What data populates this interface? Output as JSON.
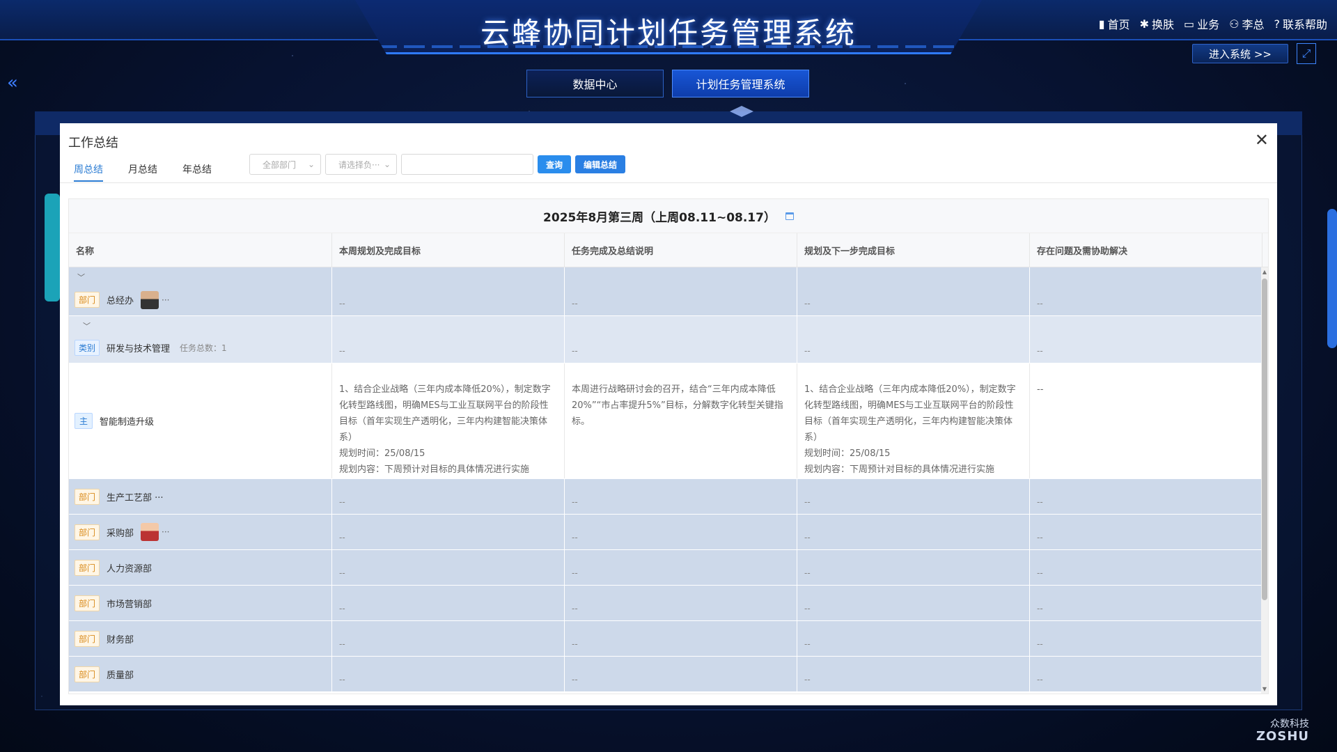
{
  "header": {
    "system_title": "云蜂协同计划任务管理系统",
    "nav": [
      {
        "icon": "bar-chart-icon",
        "label": "首页"
      },
      {
        "icon": "skin-icon",
        "label": "换肤"
      },
      {
        "icon": "monitor-icon",
        "label": "业务"
      },
      {
        "icon": "user-icon",
        "label": "李总"
      },
      {
        "icon": "help-icon",
        "label": "联系帮助"
      }
    ],
    "enter_label": "进入系统 >>",
    "tabs": [
      {
        "label": "数据中心",
        "active": false
      },
      {
        "label": "计划任务管理系统",
        "active": true
      }
    ]
  },
  "watermark": {
    "cn": "众数科技",
    "en": "ZOSHU"
  },
  "modal": {
    "title": "工作总结",
    "tabs": [
      {
        "label": "周总结",
        "active": true
      },
      {
        "label": "月总结",
        "active": false
      },
      {
        "label": "年总结",
        "active": false
      }
    ],
    "filters": {
      "department_placeholder": "全部部门",
      "person_placeholder": "请选择负···",
      "search_value": "",
      "query_label": "查询",
      "edit_label": "编辑总结"
    },
    "week_title": "2025年8月第三周（上周08.11~08.17）",
    "columns": [
      "名称",
      "本周规划及完成目标",
      "任务完成及总结说明",
      "规划及下一步完成目标",
      "存在问题及需协助解决"
    ],
    "rows": [
      {
        "type": "dept",
        "tag": "部门",
        "name": "总经办",
        "avatar": "dark",
        "collapsible": true,
        "cells": [
          "--",
          "--",
          "--",
          "--"
        ]
      },
      {
        "type": "category",
        "tag": "类别",
        "name": "研发与技术管理",
        "extra": "任务总数：1",
        "collapsible": true,
        "cells": [
          "--",
          "--",
          "--",
          "--"
        ]
      },
      {
        "type": "task",
        "tag": "主",
        "name": "智能制造升级",
        "cells": [
          "1、结合企业战略（三年内成本降低20%），制定数字化转型路线图，明确MES与工业互联网平台的阶段性目标（首年实现生产透明化，三年内构建智能决策体系）",
          "本周进行战略研讨会的召开，结合“三年内成本降低20%”“市占率提升5%”目标，分解数字化转型关键指标。",
          "1、结合企业战略（三年内成本降低20%），制定数字化转型路线图，明确MES与工业互联网平台的阶段性目标（首年实现生产透明化，三年内构建智能决策体系）",
          "--"
        ],
        "plan_time": "规划时间：25/08/15",
        "plan_content": "规划内容：下周预计对目标的具体情况进行实施"
      },
      {
        "type": "dept",
        "tag": "部门",
        "name": "生产工艺部 ···",
        "cells": [
          "--",
          "--",
          "--",
          "--"
        ]
      },
      {
        "type": "dept",
        "tag": "部门",
        "name": "采购部",
        "avatar": "red",
        "cells": [
          "--",
          "--",
          "--",
          "--"
        ]
      },
      {
        "type": "dept",
        "tag": "部门",
        "name": "人力资源部",
        "cells": [
          "--",
          "--",
          "--",
          "--"
        ]
      },
      {
        "type": "dept",
        "tag": "部门",
        "name": "市场营销部",
        "cells": [
          "--",
          "--",
          "--",
          "--"
        ]
      },
      {
        "type": "dept",
        "tag": "部门",
        "name": "财务部",
        "cells": [
          "--",
          "--",
          "--",
          "--"
        ]
      },
      {
        "type": "dept",
        "tag": "部门",
        "name": "质量部",
        "cells": [
          "--",
          "--",
          "--",
          "--"
        ]
      }
    ]
  }
}
